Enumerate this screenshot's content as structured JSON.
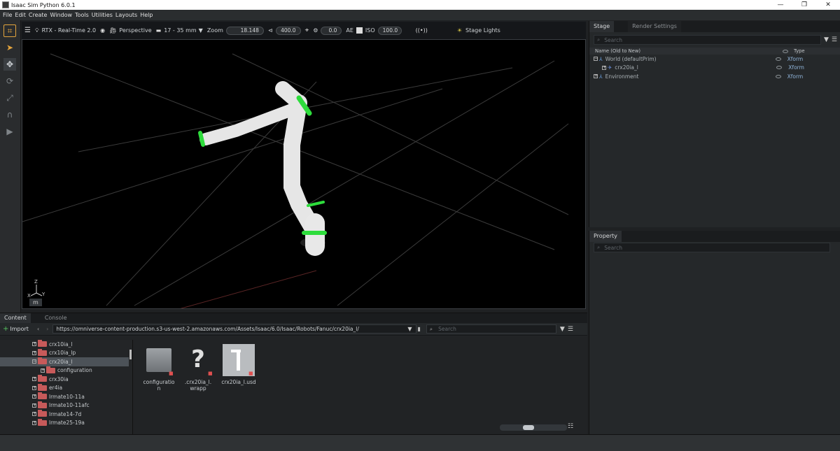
{
  "window": {
    "title": "Isaac Sim Python 6.0.1",
    "controls": [
      "—",
      "❐",
      "✕"
    ]
  },
  "menu": [
    "File",
    "Edit",
    "Create",
    "Window",
    "Tools",
    "Utilities",
    "Layouts",
    "Help"
  ],
  "viewport_toolbar": {
    "renderer": "RTX - Real-Time 2.0",
    "camera": "Perspective",
    "lens": "17 - 35 mm",
    "zoom_label": "Zoom",
    "zoom_value": "18.148",
    "angle_value": "400.0",
    "exposure_value": "0.0",
    "ae_label": "AE",
    "iso_label": "ISO",
    "iso_value": "100.0",
    "lights": "Stage Lights"
  },
  "viewport": {
    "unit": "m",
    "axes": {
      "z": "Z",
      "x": "X",
      "y": "Y"
    }
  },
  "stage": {
    "tabs": [
      "Stage",
      "Render Settings"
    ],
    "search_placeholder": "Search",
    "col_name": "Name (Old to New)",
    "col_type": "Type",
    "rows": [
      {
        "name": "World (defaultPrim)",
        "type": "Xform"
      },
      {
        "name": "crx20ia_l",
        "type": "Xform"
      },
      {
        "name": "Environment",
        "type": "Xform"
      }
    ]
  },
  "property": {
    "tab": "Property",
    "search_placeholder": "Search"
  },
  "content": {
    "tabs": [
      "Content",
      "Console"
    ],
    "import_label": "Import",
    "path": "https://omniverse-content-production.s3-us-west-2.amazonaws.com/Assets/Isaac/6.0/Isaac/Robots/Fanuc/crx20ia_l/",
    "search_placeholder": "Search",
    "tree": [
      "crx10ia_l",
      "crx10ia_lp",
      "crx20ia_l",
      "configuration",
      "crx30ia",
      "er4ia",
      "lrmate10-11a",
      "lrmate10-11afc",
      "lrmate14-7d",
      "lrmate25-19a"
    ],
    "files": [
      {
        "line1": "configuratio",
        "line2": "n"
      },
      {
        "line1": ".crx20ia_l.",
        "line2": "wrapp"
      },
      {
        "line1": "crx20ia_l.usd",
        "line2": ""
      }
    ]
  }
}
